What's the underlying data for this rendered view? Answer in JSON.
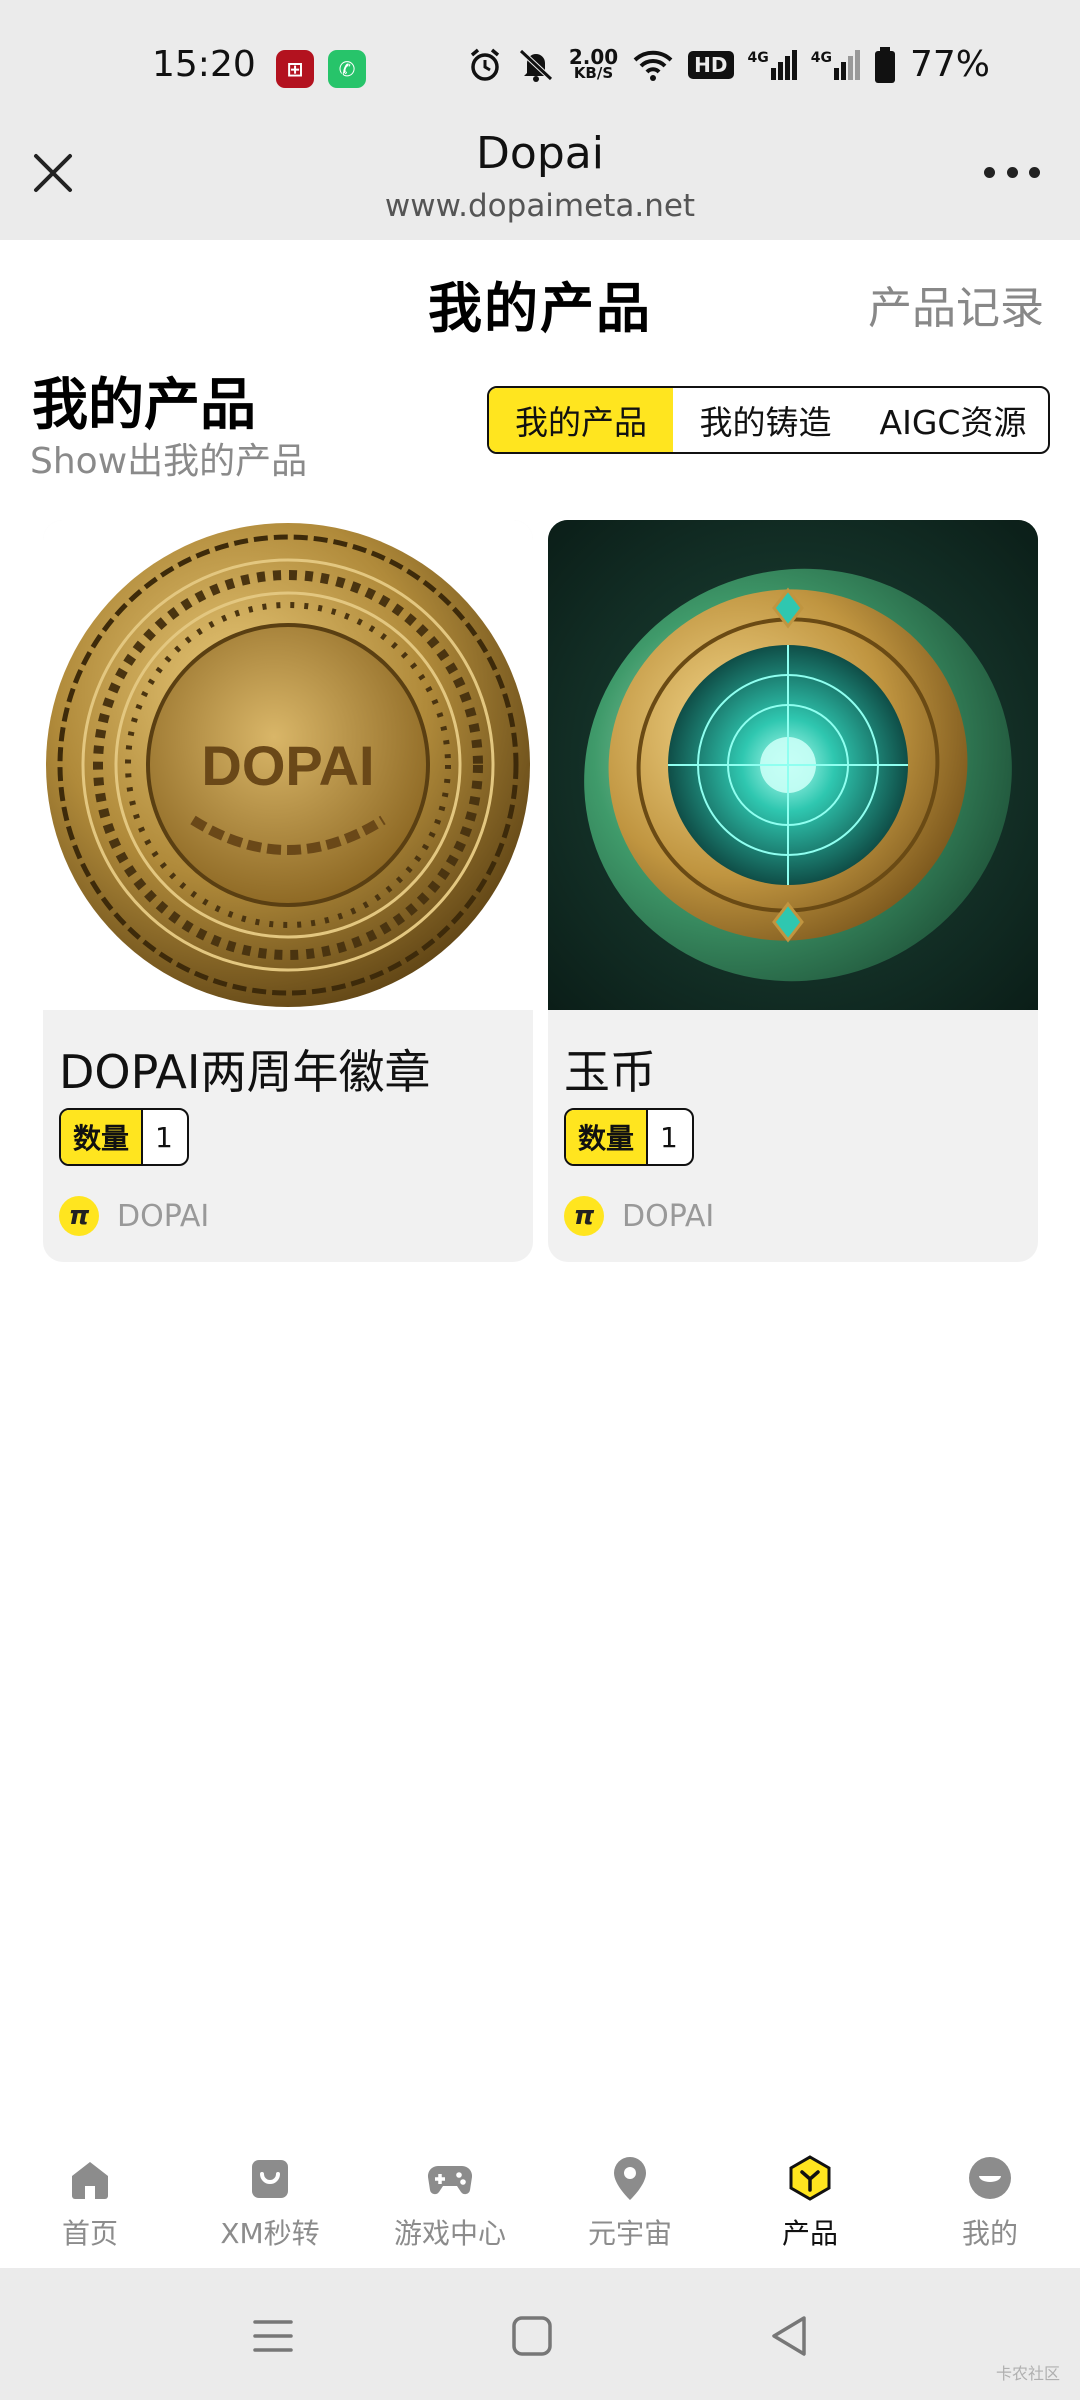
{
  "status_bar": {
    "time": "15:20",
    "net_speed_value": "2.00",
    "net_speed_unit": "KB/S",
    "network_1": "4G",
    "network_2": "4G",
    "hd_label": "HD",
    "battery": "77%"
  },
  "browser": {
    "title": "Dopai",
    "url": "www.dopaimeta.net"
  },
  "page": {
    "title": "我的产品",
    "records_link": "产品记录"
  },
  "section": {
    "title": "我的产品",
    "subtitle": "Show出我的产品"
  },
  "tabs": [
    {
      "label": "我的产品",
      "active": true
    },
    {
      "label": "我的铸造",
      "active": false
    },
    {
      "label": "AIGC资源",
      "active": false
    }
  ],
  "products": [
    {
      "name": "DOPAI两周年徽章",
      "quantity_label": "数量",
      "quantity": "1",
      "creator": "DOPAI",
      "image_text": "DOPAI"
    },
    {
      "name": "玉币",
      "quantity_label": "数量",
      "quantity": "1",
      "creator": "DOPAI"
    }
  ],
  "bottom_nav": [
    {
      "label": "首页",
      "icon": "home-icon"
    },
    {
      "label": "XM秒转",
      "icon": "bag-icon"
    },
    {
      "label": "游戏中心",
      "icon": "gamepad-icon"
    },
    {
      "label": "元宇宙",
      "icon": "location-pin-icon"
    },
    {
      "label": "产品",
      "icon": "product-hexagon-icon",
      "active": true
    },
    {
      "label": "我的",
      "icon": "profile-face-icon"
    }
  ],
  "watermark": "卡农社区",
  "colors": {
    "accent": "#ffe51f",
    "bar_bg": "#ebebeb",
    "card_bg": "#f1f1f1"
  }
}
